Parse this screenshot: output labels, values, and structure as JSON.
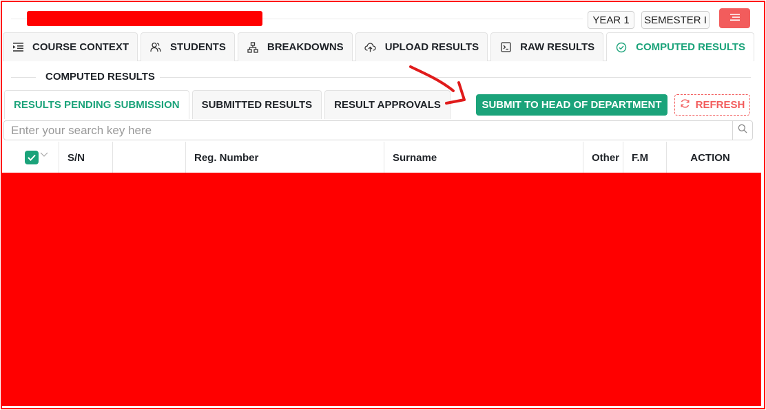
{
  "header": {
    "year": "YEAR 1",
    "semester": "SEMESTER I"
  },
  "tabs": [
    {
      "label": "COURSE CONTEXT",
      "icon": "indent-list-icon"
    },
    {
      "label": "STUDENTS",
      "icon": "users-icon"
    },
    {
      "label": "BREAKDOWNS",
      "icon": "hierarchy-icon"
    },
    {
      "label": "UPLOAD RESULTS",
      "icon": "cloud-upload-icon"
    },
    {
      "label": "RAW RESULTS",
      "icon": "terminal-icon"
    },
    {
      "label": "COMPUTED RESULTS",
      "icon": "check-circle-icon",
      "active": true
    }
  ],
  "section_title": "COMPUTED RESULTS",
  "subtabs": [
    {
      "label": "RESULTS PENDING SUBMISSION",
      "active": true
    },
    {
      "label": "SUBMITTED RESULTS"
    },
    {
      "label": "RESULT APPROVALS"
    }
  ],
  "actions": {
    "submit": "SUBMIT TO HEAD OF DEPARTMENT",
    "refresh": "REFRESH"
  },
  "search": {
    "placeholder": "Enter your search key here",
    "value": ""
  },
  "table": {
    "select_all_checked": true,
    "columns": [
      "S/N",
      "",
      "Reg. Number",
      "Surname",
      "Other Names",
      "F.M",
      "ACTION"
    ]
  },
  "colors": {
    "accent": "#1ba37a",
    "danger": "#f25c5c",
    "redaction": "#ff0000"
  }
}
